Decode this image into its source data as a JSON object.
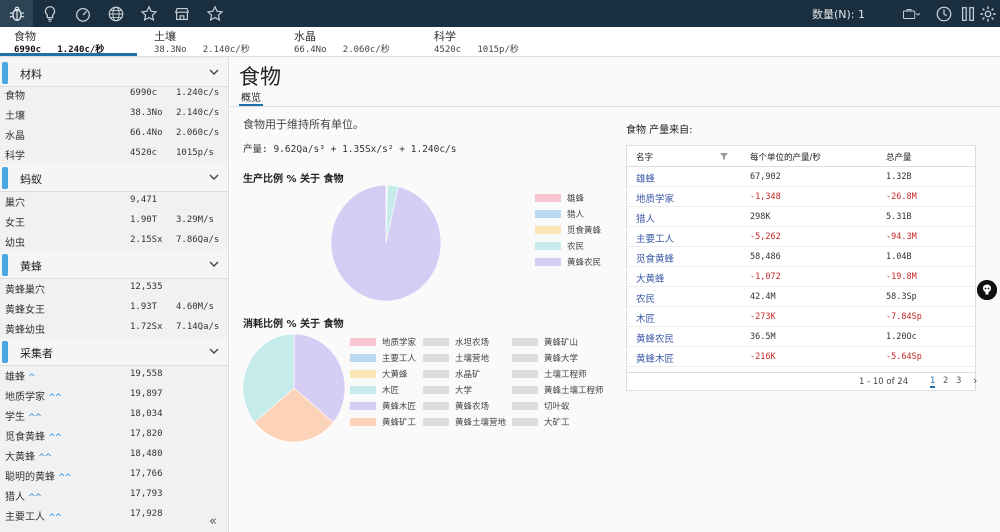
{
  "topbar": {
    "icons": [
      "bug-icon",
      "lightbulb-icon",
      "speedometer-icon",
      "globe-icon",
      "star-outline-icon",
      "shop-icon",
      "star-icon"
    ],
    "count_label": "数量(N): 1",
    "right_icons": [
      "briefcase-icon",
      "clock-icon",
      "pause-icon",
      "gear-icon"
    ],
    "bg_color": "#1a2f3f"
  },
  "resource_tabs": [
    {
      "name": "食物",
      "amount": "6990c",
      "rate": "1.240c/秒"
    },
    {
      "name": "土壤",
      "amount": "38.3No",
      "rate": "2.140c/秒"
    },
    {
      "name": "水晶",
      "amount": "66.4No",
      "rate": "2.060c/秒"
    },
    {
      "name": "科学",
      "amount": "4520c",
      "rate": "1015p/秒"
    }
  ],
  "sidebar": {
    "sections": [
      {
        "title": "材料",
        "rows": [
          {
            "name": "食物",
            "v1": "6990c",
            "v2": "1.240c/s"
          },
          {
            "name": "土壤",
            "v1": "38.3No",
            "v2": "2.140c/s"
          },
          {
            "name": "水晶",
            "v1": "66.4No",
            "v2": "2.060c/s"
          },
          {
            "name": "科学",
            "v1": "4520c",
            "v2": "1015p/s"
          }
        ]
      },
      {
        "title": "蚂蚁",
        "rows": [
          {
            "name": "巢穴",
            "v1": "9,471",
            "v2": ""
          },
          {
            "name": "女王",
            "v1": "1.90T",
            "v2": "3.29M/s"
          },
          {
            "name": "幼虫",
            "v1": "2.15Sx",
            "v2": "7.86Qa/s"
          }
        ]
      },
      {
        "title": "黄蜂",
        "rows": [
          {
            "name": "黄蜂巢穴",
            "v1": "12,535",
            "v2": ""
          },
          {
            "name": "黄蜂女王",
            "v1": "1.93T",
            "v2": "4.60M/s"
          },
          {
            "name": "黄蜂幼虫",
            "v1": "1.72Sx",
            "v2": "7.14Qa/s"
          }
        ]
      },
      {
        "title": "采集者",
        "rows": [
          {
            "name": "雄蜂",
            "v1": "19,558",
            "v2": "",
            "up": "^"
          },
          {
            "name": "地质学家",
            "v1": "19,897",
            "v2": "",
            "up": "^^"
          },
          {
            "name": "学生",
            "v1": "18,034",
            "v2": "",
            "up": "^^"
          },
          {
            "name": "觅食黄蜂",
            "v1": "17,820",
            "v2": "",
            "up": "^^"
          },
          {
            "name": "大黄蜂",
            "v1": "18,480",
            "v2": "",
            "up": "^^"
          },
          {
            "name": "聪明的黄蜂",
            "v1": "17,766",
            "v2": "",
            "up": "^^"
          },
          {
            "name": "猎人",
            "v1": "17,793",
            "v2": "",
            "up": "^^"
          },
          {
            "name": "主要工人",
            "v1": "17,928",
            "v2": "",
            "up": "^^"
          }
        ]
      }
    ],
    "collapse_label": "«"
  },
  "main": {
    "title": "食物",
    "tab": "概览",
    "description": "食物用于维持所有单位。",
    "production_label": "产量:",
    "production_eq": " 9.62Qa/s³ + 1.35Sx/s² + 1.240c/s"
  },
  "production_chart": {
    "title": "生产比例 % 关于 食物",
    "type": "pie",
    "legend": [
      {
        "label": "雄蜂",
        "color": "#f7c5cf"
      },
      {
        "label": "猎人",
        "color": "#bcd9f2"
      },
      {
        "label": "觅食黄蜂",
        "color": "#fbe6b3"
      },
      {
        "label": "农民",
        "color": "#c5ecea"
      },
      {
        "label": "黄蜂农民",
        "color": "#d6cdf5"
      }
    ]
  },
  "consumption_chart": {
    "title": "消耗比例 % 关于 食物",
    "type": "pie",
    "legend": [
      {
        "label": "地质学家",
        "color": "#f7c5cf"
      },
      {
        "label": "水坦农场",
        "color": "#dddddd"
      },
      {
        "label": "黄蜂矿山",
        "color": "#dddddd"
      },
      {
        "label": "主要工人",
        "color": "#bcd9f2"
      },
      {
        "label": "土壤营地",
        "color": "#dddddd"
      },
      {
        "label": "黄蜂大学",
        "color": "#dddddd"
      },
      {
        "label": "大黄蜂",
        "color": "#fbe6b3"
      },
      {
        "label": "水晶矿",
        "color": "#dddddd"
      },
      {
        "label": "土壤工程师",
        "color": "#dddddd"
      },
      {
        "label": "木匠",
        "color": "#c5ecea"
      },
      {
        "label": "大学",
        "color": "#dddddd"
      },
      {
        "label": "黄蜂土壤工程师",
        "color": "#dddddd"
      },
      {
        "label": "黄蜂木匠",
        "color": "#d6cdf5"
      },
      {
        "label": "黄蜂农场",
        "color": "#dddddd"
      },
      {
        "label": "切叶蚁",
        "color": "#dddddd"
      },
      {
        "label": "黄蜂矿工",
        "color": "#fcd3b8"
      },
      {
        "label": "黄蜂土壤营地",
        "color": "#dddddd"
      },
      {
        "label": "大矿工",
        "color": "#dddddd"
      }
    ]
  },
  "chart_data": [
    {
      "type": "pie",
      "title": "生产比例 % 关于 食物",
      "slices": [
        {
          "label": "雄蜂",
          "value": 0.1,
          "color": "#f7c5cf"
        },
        {
          "label": "猎人",
          "value": 0.1,
          "color": "#bcd9f2"
        },
        {
          "label": "觅食黄蜂",
          "value": 0.2,
          "color": "#fbe6b3"
        },
        {
          "label": "农民",
          "value": 3.2,
          "color": "#c5ecea"
        },
        {
          "label": "黄蜂农民",
          "value": 96.4,
          "color": "#d6cdf5"
        }
      ]
    },
    {
      "type": "pie",
      "title": "消耗比例 % 关于 食物",
      "slices": [
        {
          "label": "黄蜂木匠",
          "value": 36,
          "color": "#d6cdf5"
        },
        {
          "label": "黄蜂矿工",
          "value": 28,
          "color": "#fcd3b8"
        },
        {
          "label": "木匠",
          "value": 36,
          "color": "#c5ecea"
        }
      ]
    }
  ],
  "sources": {
    "title": "食物 产量来自:",
    "headers": [
      "名字",
      "每个单位的产量/秒",
      "总产量"
    ],
    "rows": [
      {
        "name": "雄蜂",
        "per_unit": "67,902",
        "total": "1.32B",
        "neg": false
      },
      {
        "name": "地质学家",
        "per_unit": "-1,348",
        "total": "-26.8M",
        "neg": true
      },
      {
        "name": "猎人",
        "per_unit": "298K",
        "total": "5.31B",
        "neg": false
      },
      {
        "name": "主要工人",
        "per_unit": "-5,262",
        "total": "-94.3M",
        "neg": true
      },
      {
        "name": "觅食黄蜂",
        "per_unit": "58,486",
        "total": "1.04B",
        "neg": false
      },
      {
        "name": "大黄蜂",
        "per_unit": "-1,072",
        "total": "-19.8M",
        "neg": true
      },
      {
        "name": "农民",
        "per_unit": "42.4M",
        "total": "58.3Sp",
        "neg": false
      },
      {
        "name": "木匠",
        "per_unit": "-273K",
        "total": "-7.84Sp",
        "neg": true
      },
      {
        "name": "黄蜂农民",
        "per_unit": "36.5M",
        "total": "1.20Oc",
        "neg": false
      },
      {
        "name": "黄蜂木匠",
        "per_unit": "-216K",
        "total": "-5.64Sp",
        "neg": true
      }
    ],
    "pager": {
      "info": "1 - 10 of 24",
      "pages": [
        "1",
        "2",
        "3"
      ],
      "current": "1",
      "next": "›"
    }
  }
}
